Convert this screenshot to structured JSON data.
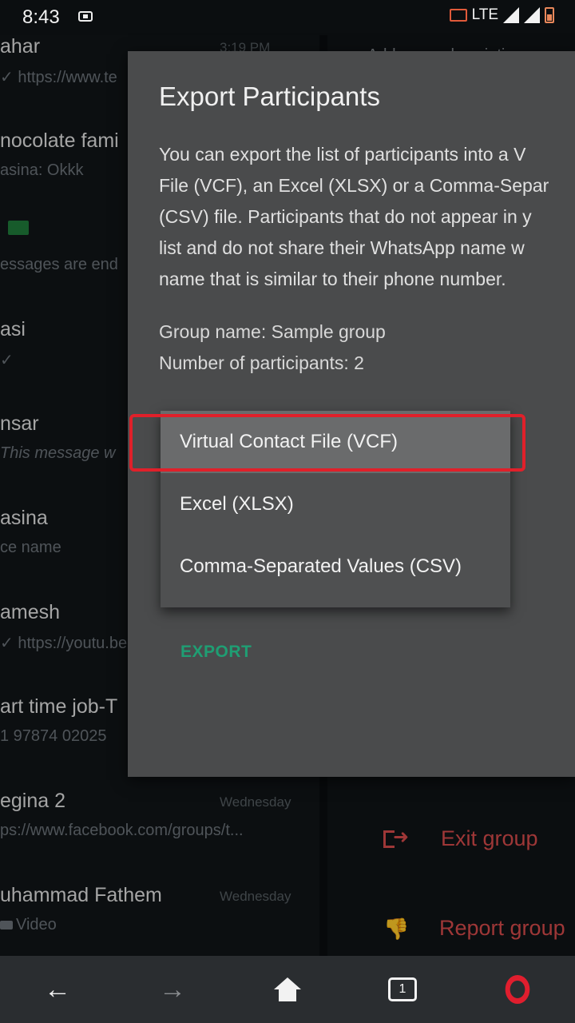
{
  "status_bar": {
    "time": "8:43",
    "network": "LTE"
  },
  "chat_list": [
    {
      "name": "ahar",
      "time": "3:19 PM",
      "message": "✓ https://www.te"
    },
    {
      "name": "nocolate fami",
      "time": "",
      "message": "asina: Okkk"
    },
    {
      "name": "",
      "time": "",
      "message": "essages are end"
    },
    {
      "name": "asi",
      "time": "",
      "message": "✓"
    },
    {
      "name": "nsar",
      "time": "",
      "message": "This message w"
    },
    {
      "name": "asina",
      "time": "",
      "message": "ce name"
    },
    {
      "name": "amesh",
      "time": "",
      "message": "✓ https://youtu.be"
    },
    {
      "name": "art time job-T",
      "time": "",
      "message": "1 97874 02025"
    },
    {
      "name": "egina 2",
      "time": "Wednesday",
      "message": "ps://www.facebook.com/groups/t..."
    },
    {
      "name": "uhammad Fathem",
      "time": "Wednesday",
      "message": "Video"
    }
  ],
  "right_pane": {
    "add_description": "Add group description",
    "exit_group": "Exit group",
    "report_group": "Report group"
  },
  "dialog": {
    "title": "Export Participants",
    "body_lines": [
      "You can export the list of participants into a V",
      "File (VCF), an Excel (XLSX) or a Comma-Separ",
      "(CSV) file. Participants that do not appear in y",
      "list and do not share their WhatsApp name w",
      "name that is similar to their phone number."
    ],
    "group_name_line": "Group name: Sample group",
    "participants_line": "Number of participants: 2",
    "export_label": "EXPORT",
    "menu_items": [
      "Virtual Contact File (VCF)",
      "Excel (XLSX)",
      "Comma-Separated Values (CSV)"
    ]
  },
  "nav": {
    "icons": [
      "back-arrow-icon",
      "forward-arrow-icon",
      "home-icon",
      "tabs-icon",
      "opera-icon"
    ],
    "tab_count": "1"
  },
  "colors": {
    "accent": "#1f9e73",
    "danger": "#d34a4a",
    "highlight": "#e0202a",
    "opera": "#e01e2e"
  }
}
